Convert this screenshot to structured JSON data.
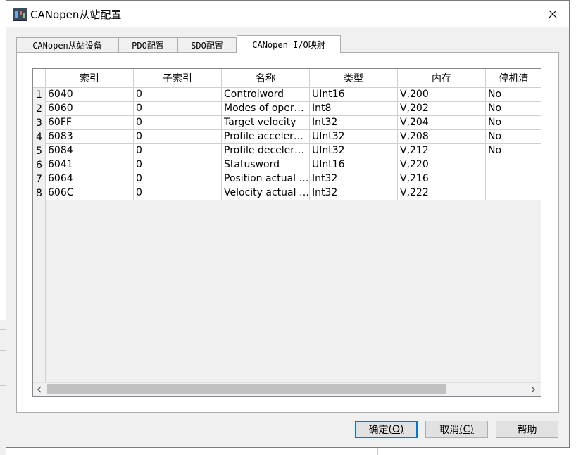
{
  "window": {
    "title": "CANopen从站配置",
    "close_glyph": "✕"
  },
  "tabs": [
    {
      "label": "CANopen从站设备",
      "active": false
    },
    {
      "label": "PDO配置",
      "active": false
    },
    {
      "label": "SDO配置",
      "active": false
    },
    {
      "label": "CANopen I/O映射",
      "active": true
    }
  ],
  "table": {
    "columns": [
      "索引",
      "子索引",
      "名称",
      "类型",
      "内存",
      "停机清"
    ],
    "rows": [
      {
        "num": "1",
        "cells": [
          "6040",
          "0",
          "Controlword",
          "UInt16",
          "V,200",
          "No"
        ]
      },
      {
        "num": "2",
        "cells": [
          "6060",
          "0",
          "Modes of operation",
          "Int8",
          "V,202",
          "No"
        ]
      },
      {
        "num": "3",
        "cells": [
          "60FF",
          "0",
          "Target velocity",
          "Int32",
          "V,204",
          "No"
        ]
      },
      {
        "num": "4",
        "cells": [
          "6083",
          "0",
          "Profile acceleration",
          "UInt32",
          "V,208",
          "No"
        ]
      },
      {
        "num": "5",
        "cells": [
          "6084",
          "0",
          "Profile deceleration",
          "UInt32",
          "V,212",
          "No"
        ]
      },
      {
        "num": "6",
        "cells": [
          "6041",
          "0",
          "Statusword",
          "UInt16",
          "V,220",
          ""
        ]
      },
      {
        "num": "7",
        "cells": [
          "6064",
          "0",
          "Position actual value",
          "Int32",
          "V,216",
          ""
        ]
      },
      {
        "num": "8",
        "cells": [
          "606C",
          "0",
          "Velocity actual value",
          "Int32",
          "V,222",
          ""
        ]
      }
    ]
  },
  "buttons": {
    "ok": {
      "label": "确定",
      "accel": "(O)"
    },
    "cancel": {
      "label": "取消",
      "accel": "(C)"
    },
    "help": {
      "label": "帮助"
    }
  },
  "icons": {
    "app": "app-icon",
    "close": "close-icon",
    "scroll_left": "chevron-left-icon",
    "scroll_right": "chevron-right-icon"
  }
}
